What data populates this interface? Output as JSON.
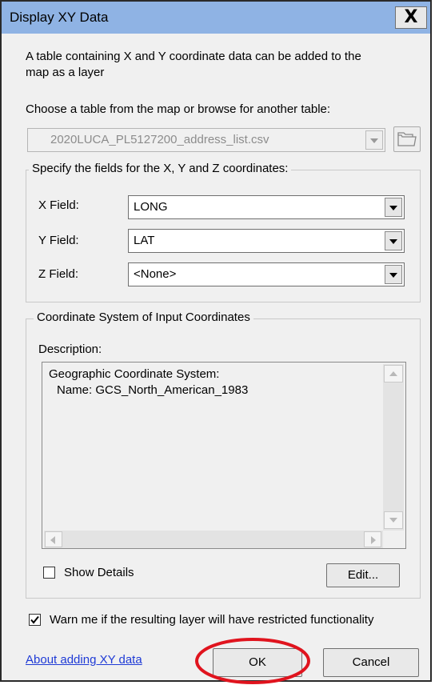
{
  "window": {
    "title": "Display XY Data",
    "close_glyph": "X"
  },
  "intro": {
    "line1": "A table containing X and Y coordinate data can be added to the",
    "line2": "map as a layer"
  },
  "choose_label": "Choose a table from the map or browse for another table:",
  "table_combo": {
    "value": "2020LUCA_PL5127200_address_list.csv",
    "disabled": true
  },
  "fields_group": {
    "legend": "Specify the fields for the X, Y and Z coordinates:",
    "x_label": "X Field:",
    "x_value": "LONG",
    "y_label": "Y Field:",
    "y_value": "LAT",
    "z_label": "Z Field:",
    "z_value": "<None>"
  },
  "coord_group": {
    "legend": "Coordinate System of Input Coordinates",
    "description_label": "Description:",
    "description_line1": "Geographic Coordinate System:",
    "description_line2": "Name: GCS_North_American_1983",
    "show_details_label": "Show Details",
    "show_details_checked": false,
    "edit_label": "Edit..."
  },
  "warn": {
    "label": "Warn me if the resulting layer will have restricted functionality",
    "checked": true
  },
  "footer": {
    "about_link": "About adding XY data",
    "ok_label": "OK",
    "cancel_label": "Cancel"
  },
  "colors": {
    "titlebar": "#8fb3e4",
    "link": "#1f3bd6",
    "highlight_ellipse": "#e0141e",
    "dialog_bg": "#f0f0f0"
  },
  "icons": [
    "close-icon",
    "folder-browse-icon",
    "dropdown-arrow-icon",
    "scroll-up-icon",
    "scroll-down-icon",
    "scroll-left-icon",
    "scroll-right-icon",
    "checkmark-icon"
  ]
}
